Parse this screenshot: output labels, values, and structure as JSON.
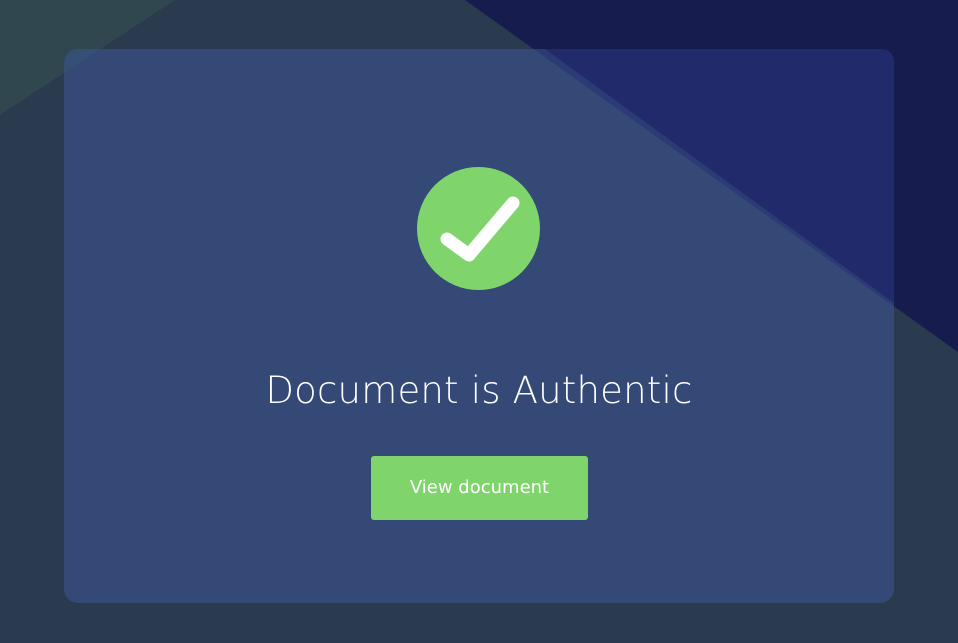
{
  "status": {
    "icon": "check-circle-icon",
    "title": "Document is Authentic"
  },
  "actions": {
    "view_label": "View document"
  },
  "colors": {
    "background_base": "#2a3a4f",
    "background_top_left": "#30474f",
    "background_navy": "#161c4e",
    "background_mid_navy": "#212a6a",
    "card": "#324573",
    "success_green": "#7fd56b",
    "text": "#ffffff"
  }
}
